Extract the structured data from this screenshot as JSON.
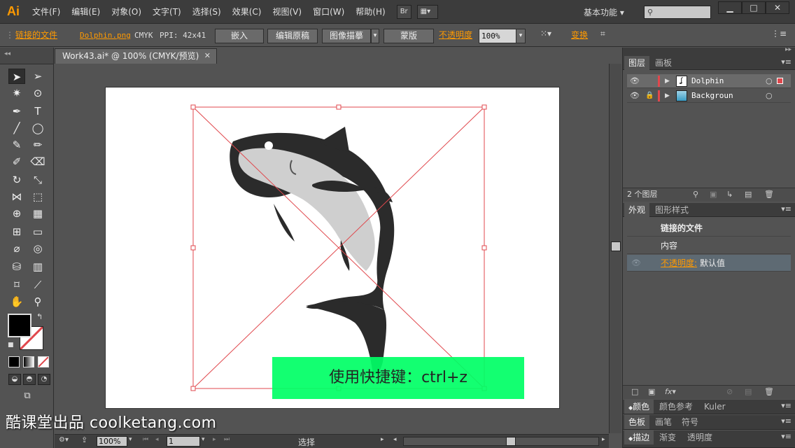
{
  "menubar": {
    "logo": "Ai",
    "items": [
      "文件(F)",
      "编辑(E)",
      "对象(O)",
      "文字(T)",
      "选择(S)",
      "效果(C)",
      "视图(V)",
      "窗口(W)",
      "帮助(H)"
    ],
    "bridge": "Br",
    "workspace": "基本功能"
  },
  "controlbar": {
    "linked_file": "链接的文件",
    "filename": "Dolphin.png",
    "colormode": "CMYK",
    "ppi": "PPI: 42x41",
    "embed": "嵌入",
    "edit_original": "编辑原稿",
    "image_trace": "图像描摹",
    "mask": "蒙版",
    "opacity_label": "不透明度",
    "opacity_value": "100%",
    "transform": "变换"
  },
  "document": {
    "tab_title": "Work43.ai* @ 100% (CMYK/预览)",
    "caption": "使用快捷键：ctrl+z"
  },
  "statusbar": {
    "zoom": "100%",
    "page": "1",
    "tool_name": "选择"
  },
  "layers_panel": {
    "tabs": [
      "图层",
      "画板"
    ],
    "layers": [
      {
        "name": "Dolphin",
        "selected": true
      },
      {
        "name": "Backgroun",
        "selected": false
      }
    ],
    "count": "2 个图层"
  },
  "appearance_panel": {
    "tabs": [
      "外观",
      "图形样式"
    ],
    "title": "链接的文件",
    "content": "内容",
    "opacity_label": "不透明度:",
    "opacity_value": "默认值"
  },
  "collapsed_panels": [
    {
      "tabs": [
        "颜色",
        "颜色参考",
        "Kuler"
      ]
    },
    {
      "tabs": [
        "色板",
        "画笔",
        "符号"
      ]
    },
    {
      "tabs": [
        "描边",
        "渐变",
        "透明度"
      ]
    }
  ],
  "watermark": "酷课堂出品 coolketang.com",
  "colors": {
    "accent": "#ff9a00",
    "selection": "#e0474c",
    "caption_bg": "#00ff66",
    "fish_dark": "#2b2b2b",
    "fish_light": "#cfcfcf"
  }
}
